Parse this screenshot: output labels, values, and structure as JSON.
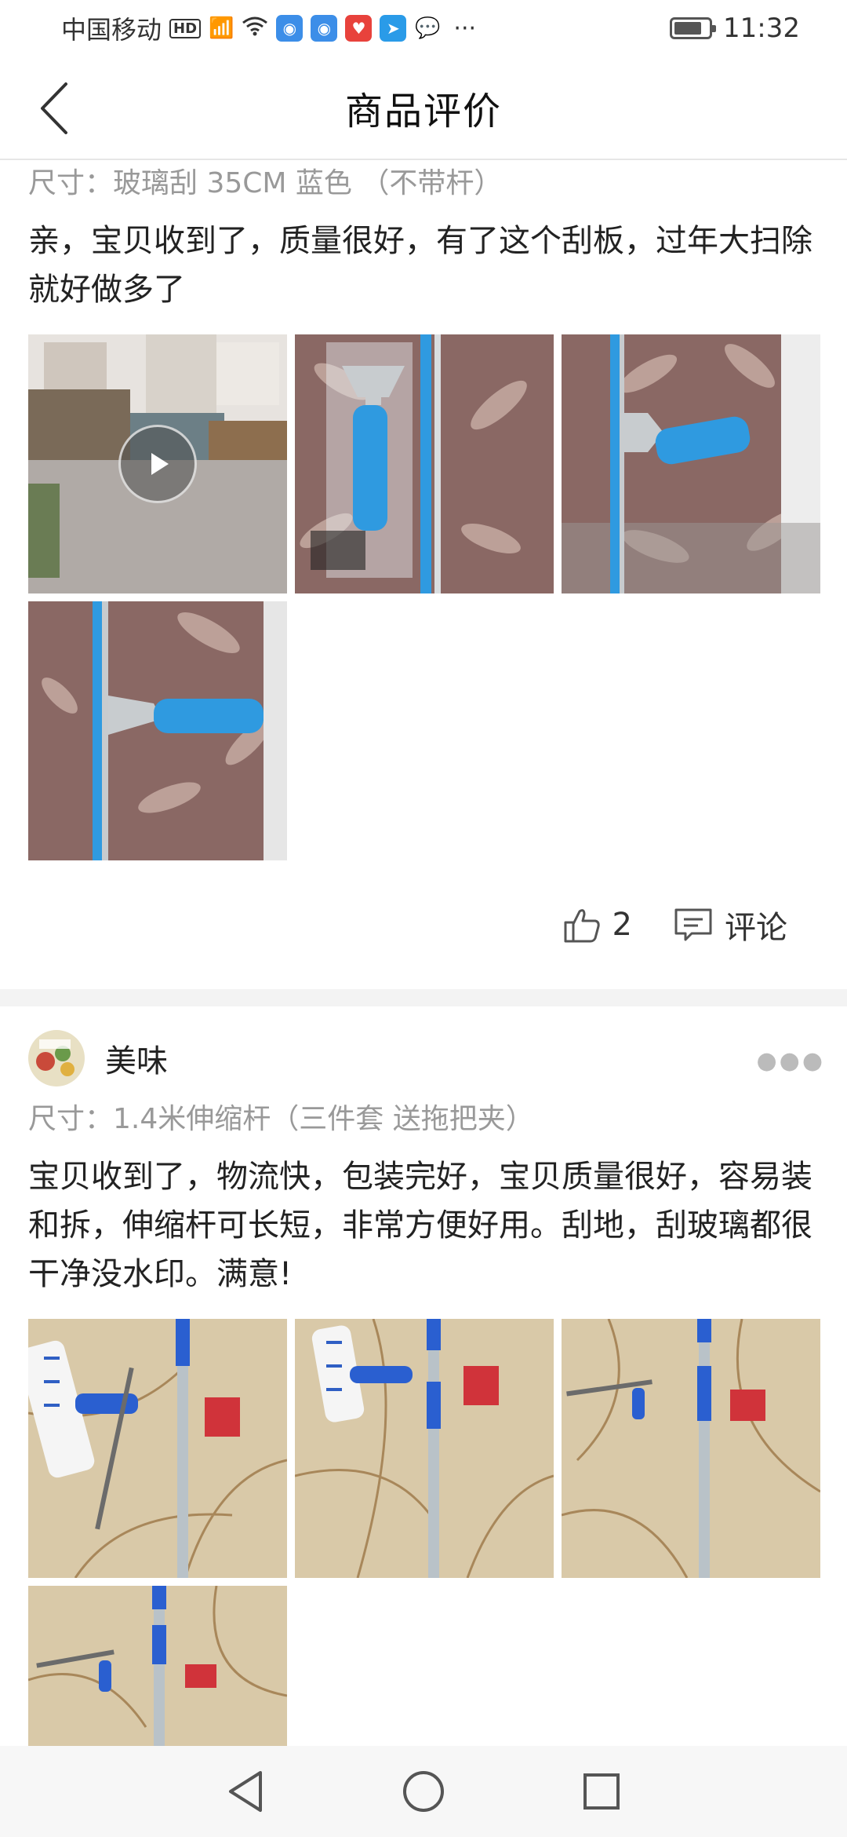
{
  "status_bar": {
    "carrier": "中国移动",
    "hd": "HD",
    "network": "4G",
    "time": "11:32",
    "battery_level": 0.8
  },
  "header": {
    "title": "商品评价",
    "back_icon": "chevron-left-icon"
  },
  "reviews": [
    {
      "spec": "尺寸：玻璃刮 35CM 蓝色 （不带杆）",
      "text": "亲，宝贝收到了，质量很好，有了这个刮板，过年大扫除就好做多了",
      "like_count": "2",
      "comment_label": "评论"
    },
    {
      "username": "美味",
      "spec": "尺寸：1.4米伸缩杆（三件套  送拖把夹）",
      "text": "宝贝收到了，物流快，包装完好，宝贝质量很好，容易装和拆，伸缩杆可长短，非常方便好用。刮地，刮玻璃都很干净没水印。满意!"
    }
  ],
  "colors": {
    "accent_blue": "#2f9ae0",
    "tablecloth": "#8a6864",
    "tile": "#d9c9a8"
  }
}
